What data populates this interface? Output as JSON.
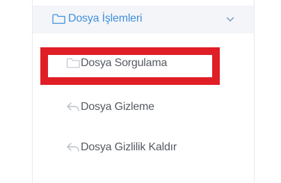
{
  "menu": {
    "group": {
      "icon": "folder-icon",
      "title": "Dosya İşlemleri",
      "toggle_icon": "chevron-down-icon"
    },
    "items": [
      {
        "icon": "folder-icon",
        "label": "Dosya Sorgulama",
        "highlighted": true
      },
      {
        "icon": "reply-arrow-icon",
        "label": "Dosya Gizleme"
      },
      {
        "icon": "reply-arrow-icon",
        "label": "Dosya Gizlilik Kaldır"
      }
    ]
  },
  "colors": {
    "accent": "#3f8fdc",
    "header_bg": "#f3f5f8",
    "item_text": "#555a62",
    "icon_gray": "#b9bec6",
    "highlight": "#e01e26"
  }
}
